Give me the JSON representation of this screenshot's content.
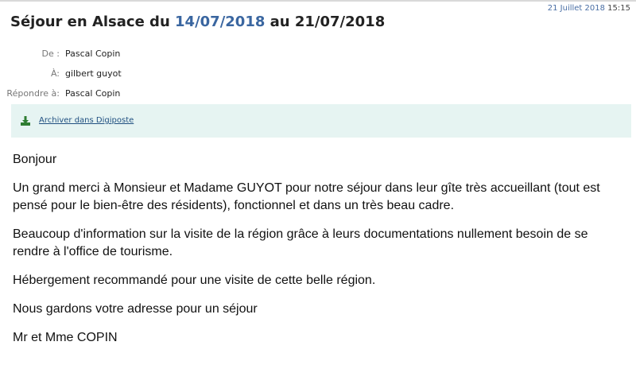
{
  "message": {
    "date": "21 Juillet 2018",
    "time": "15:15",
    "subject_parts": [
      "Séjour en Alsace du ",
      "14/07/2018",
      " au 21/07/2018"
    ],
    "headers": [
      {
        "label": "De :",
        "value": "Pascal Copin"
      },
      {
        "label": "À:",
        "value": "gilbert guyot"
      },
      {
        "label": "Répondre à:",
        "value": "Pascal Copin"
      }
    ],
    "archive_link": "Archiver dans Digiposte",
    "body": [
      "Bonjour",
      "Un grand merci à Monsieur et Madame GUYOT pour notre séjour dans leur gîte très accueillant (tout est pensé pour le bien-être des résidents), fonctionnel et dans un très beau cadre.",
      "Beaucoup d'information sur la visite de la région grâce à leurs documentations nullement besoin de se rendre à l'office de tourisme.",
      "Hébergement recommandé pour une visite de cette belle région.",
      "Nous gardons votre adresse pour un séjour",
      "Mr et Mme COPIN"
    ]
  },
  "colors": {
    "link": "#3a66a0",
    "archive_bg": "#e6f4f2",
    "archive_icon": "#2e7d32"
  },
  "icons": {
    "archive": "download-icon"
  }
}
